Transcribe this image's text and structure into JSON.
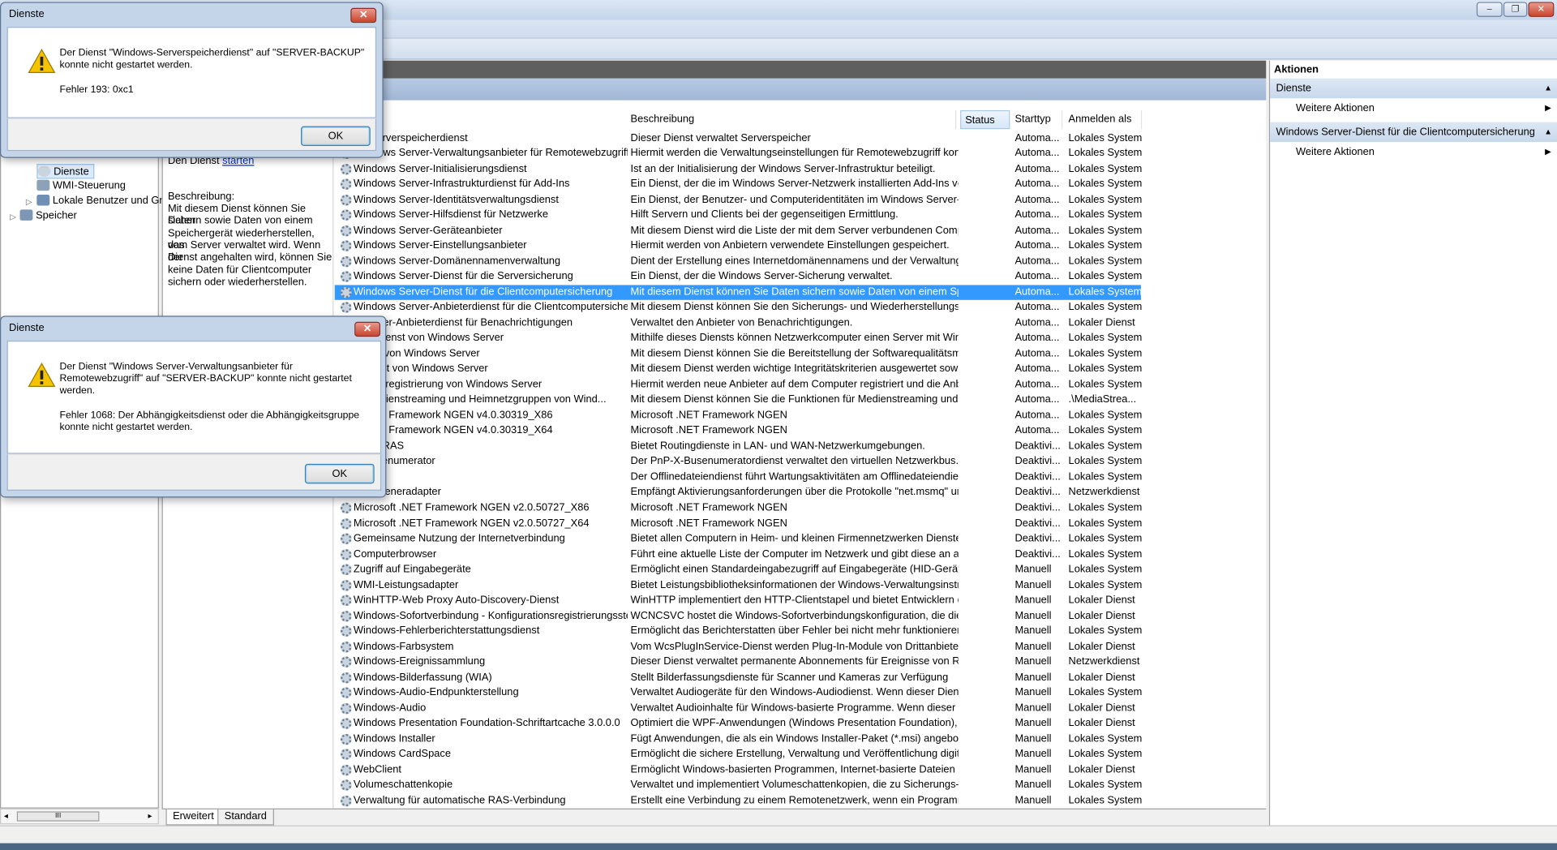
{
  "window": {
    "minimize": "‒",
    "maximize": "❐",
    "close": "✕"
  },
  "tree": {
    "items": [
      {
        "label": "Dienste",
        "selected": true
      },
      {
        "label": "WMI-Steuerung"
      },
      {
        "label": "Lokale Benutzer und Gru"
      },
      {
        "label": "Speicher"
      }
    ],
    "hscroll_thumb": "III"
  },
  "detail": {
    "start_prefix": "Den Dienst",
    "start_link": "starten",
    "desc_heading": "Beschreibung:",
    "desc_lines": [
      "Mit diesem Dienst können Sie Daten",
      "sichern sowie Daten von einem",
      "Speichergerät wiederherstellen, das",
      "vom Server verwaltet wird. Wenn der",
      "Dienst angehalten wird, können Sie",
      "keine Daten für Clientcomputer",
      "sichern oder wiederherstellen."
    ]
  },
  "columns": {
    "description": "Beschreibung",
    "status": "Status",
    "starttype": "Starttyp",
    "logon": "Anmelden als"
  },
  "services": [
    {
      "name": "ws-Serverspeicherdienst",
      "desc": "Dieser Dienst verwaltet Serverspeicher",
      "start": "Automa...",
      "logon": "Lokales System"
    },
    {
      "name": "Windows Server-Verwaltungsanbieter für Remotewebzugriff",
      "desc": "Hiermit werden die Verwaltungseinstellungen für Remotewebzugriff konfi...",
      "start": "Automa...",
      "logon": "Lokales System"
    },
    {
      "name": "Windows Server-Initialisierungsdienst",
      "desc": "Ist an der Initialisierung der Windows Server-Infrastruktur beteiligt.",
      "start": "Automa...",
      "logon": "Lokales System"
    },
    {
      "name": "Windows Server-Infrastrukturdienst für Add-Ins",
      "desc": "Ein Dienst, der die im Windows Server-Netzwerk installierten Add-Ins verw...",
      "start": "Automa...",
      "logon": "Lokales System"
    },
    {
      "name": "Windows Server-Identitätsverwaltungsdienst",
      "desc": "Ein Dienst, der Benutzer- und Computeridentitäten im Windows Server-N...",
      "start": "Automa...",
      "logon": "Lokales System"
    },
    {
      "name": "Windows Server-Hilfsdienst für Netzwerke",
      "desc": "Hilft Servern und Clients bei der gegenseitigen Ermittlung.",
      "start": "Automa...",
      "logon": "Lokales System"
    },
    {
      "name": "Windows Server-Geräteanbieter",
      "desc": "Mit diesem Dienst wird die Liste der mit dem Server verbundenen Comput...",
      "start": "Automa...",
      "logon": "Lokales System"
    },
    {
      "name": "Windows Server-Einstellungsanbieter",
      "desc": "Hiermit werden von Anbietern verwendete Einstellungen gespeichert.",
      "start": "Automa...",
      "logon": "Lokales System"
    },
    {
      "name": "Windows Server-Domänennamenverwaltung",
      "desc": "Dient der Erstellung eines Internetdomänennamens und der Verwaltung d...",
      "start": "Automa...",
      "logon": "Lokales System"
    },
    {
      "name": "Windows Server-Dienst für die Serversicherung",
      "desc": "Ein Dienst, der die Windows Server-Sicherung verwaltet.",
      "start": "Automa...",
      "logon": "Lokales System"
    },
    {
      "name": "Windows Server-Dienst für die Clientcomputersicherung",
      "desc": "Mit diesem Dienst können Sie Daten sichern sowie Daten von einem Speic...",
      "start": "Automa...",
      "logon": "Lokales System",
      "selected": true
    },
    {
      "name": "Windows Server-Anbieterdienst für die Clientcomputersicher...",
      "desc": "Mit diesem Dienst können Sie den Sicherungs- und Wiederherstellungsdie...",
      "start": "Automa...",
      "logon": "Lokales System"
    },
    {
      "name": "s Server-Anbieterdienst für Benachrichtigungen",
      "desc": "Verwaltet den Anbieter von Benachrichtigungen.",
      "start": "Automa...",
      "logon": "Lokaler Dienst"
    },
    {
      "name": "erätedienst von Windows Server",
      "desc": "Mithilfe dieses Diensts können Netzwerkcomputer einen Server mit Windo...",
      "start": "Automa...",
      "logon": "Lokales System"
    },
    {
      "name": "dienst von Windows Server",
      "desc": "Mit diesem Dienst können Sie die Bereitstellung der Softwarequalitätsmetr...",
      "start": "Automa...",
      "logon": "Lokales System"
    },
    {
      "name": "tsdienst von Windows Server",
      "desc": "Mit diesem Dienst werden wichtige Integritätskriterien ausgewertet sowie ...",
      "start": "Automa...",
      "logon": "Lokales System"
    },
    {
      "name": "nbieterregistrierung von Windows Server",
      "desc": "Hiermit werden neue Anbieter auf dem Computer registriert und die Anbi...",
      "start": "Automa...",
      "logon": "Lokales System"
    },
    {
      "name": "ür Medienstreaming und Heimnetzgruppen von Wind...",
      "desc": "Mit diesem Dienst können Sie die Funktionen für Medienstreaming und H...",
      "start": "Automa...",
      "logon": ".\\MediaStrea..."
    },
    {
      "name": "ft .NET Framework NGEN v4.0.30319_X86",
      "desc": "Microsoft .NET Framework NGEN",
      "start": "Automa...",
      "logon": "Lokales System"
    },
    {
      "name": "ft .NET Framework NGEN v4.0.30319_X64",
      "desc": "Microsoft .NET Framework NGEN",
      "start": "Automa...",
      "logon": "Lokales System"
    },
    {
      "name": "g und RAS",
      "desc": "Bietet Routingdienste in LAN- und WAN-Netzwerkumgebungen.",
      "start": "Deaktivi...",
      "logon": "Lokales System"
    },
    {
      "name": "P-Busenumerator",
      "desc": "Der PnP-X-Busenumeratordienst verwaltet den virtuellen Netzwerkbus. Er ...",
      "start": "Deaktivi...",
      "logon": "Lokales System"
    },
    {
      "name": "ateien",
      "desc": "Der Offlinedateiendienst führt Wartungsaktivitäten am Offlinedateiendien...",
      "start": "Deaktivi...",
      "logon": "Lokales System"
    },
    {
      "name": "nq-Listeneradapter",
      "desc": "Empfängt Aktivierungsanforderungen über die Protokolle \"net.msmq\" un...",
      "start": "Deaktivi...",
      "logon": "Netzwerkdienst"
    },
    {
      "name": "Microsoft .NET Framework NGEN v2.0.50727_X86",
      "desc": "Microsoft .NET Framework NGEN",
      "start": "Deaktivi...",
      "logon": "Lokales System"
    },
    {
      "name": "Microsoft .NET Framework NGEN v2.0.50727_X64",
      "desc": "Microsoft .NET Framework NGEN",
      "start": "Deaktivi...",
      "logon": "Lokales System"
    },
    {
      "name": "Gemeinsame Nutzung der Internetverbindung",
      "desc": "Bietet allen Computern in Heim- und kleinen Firmennetzwerken Dienste f...",
      "start": "Deaktivi...",
      "logon": "Lokales System"
    },
    {
      "name": "Computerbrowser",
      "desc": "Führt eine aktuelle Liste der Computer im Netzwerk und gibt diese an als ...",
      "start": "Deaktivi...",
      "logon": "Lokales System"
    },
    {
      "name": "Zugriff auf Eingabegeräte",
      "desc": "Ermöglicht einen Standardeingabezugriff auf Eingabegeräte (HID-Geräte), ...",
      "start": "Manuell",
      "logon": "Lokales System"
    },
    {
      "name": "WMI-Leistungsadapter",
      "desc": "Bietet Leistungsbibliotheksinformationen der Windows-Verwaltungsinstru...",
      "start": "Manuell",
      "logon": "Lokales System"
    },
    {
      "name": "WinHTTP-Web Proxy Auto-Discovery-Dienst",
      "desc": "WinHTTP implementiert den HTTP-Clientstapel und bietet Entwicklern ei...",
      "start": "Manuell",
      "logon": "Lokaler Dienst"
    },
    {
      "name": "Windows-Sofortverbindung - Konfigurationsregistrierungsste...",
      "desc": "WCNCSVC hostet die Windows-Sofortverbindungskonfiguration, die die I...",
      "start": "Manuell",
      "logon": "Lokaler Dienst"
    },
    {
      "name": "Windows-Fehlerberichterstattungsdienst",
      "desc": "Ermöglicht das Berichterstatten über Fehler bei nicht mehr funktionierend...",
      "start": "Manuell",
      "logon": "Lokales System"
    },
    {
      "name": "Windows-Farbsystem",
      "desc": "Vom WcsPlugInService-Dienst werden Plug-In-Module von Drittanbietern...",
      "start": "Manuell",
      "logon": "Lokaler Dienst"
    },
    {
      "name": "Windows-Ereignissammlung",
      "desc": "Dieser Dienst verwaltet permanente Abonnements für Ereignisse von Rem...",
      "start": "Manuell",
      "logon": "Netzwerkdienst"
    },
    {
      "name": "Windows-Bilderfassung (WIA)",
      "desc": "Stellt Bilderfassungsdienste für Scanner und Kameras zur Verfügung",
      "start": "Manuell",
      "logon": "Lokaler Dienst"
    },
    {
      "name": "Windows-Audio-Endpunkterstellung",
      "desc": "Verwaltet Audiogeräte für den Windows-Audiodienst. Wenn dieser Dienst ...",
      "start": "Manuell",
      "logon": "Lokales System"
    },
    {
      "name": "Windows-Audio",
      "desc": "Verwaltet Audioinhalte für Windows-basierte Programme. Wenn dieser Di...",
      "start": "Manuell",
      "logon": "Lokaler Dienst"
    },
    {
      "name": "Windows Presentation Foundation-Schriftartcache 3.0.0.0",
      "desc": "Optimiert die WPF-Anwendungen (Windows Presentation Foundation), in...",
      "start": "Manuell",
      "logon": "Lokaler Dienst"
    },
    {
      "name": "Windows Installer",
      "desc": "Fügt Anwendungen, die als ein Windows Installer-Paket (*.msi) angebote...",
      "start": "Manuell",
      "logon": "Lokales System"
    },
    {
      "name": "Windows CardSpace",
      "desc": "Ermöglicht die sichere Erstellung, Verwaltung und Veröffentlichung digital...",
      "start": "Manuell",
      "logon": "Lokales System"
    },
    {
      "name": "WebClient",
      "desc": "Ermöglicht Windows-basierten Programmen, Internet-basierte Dateien zu ...",
      "start": "Manuell",
      "logon": "Lokaler Dienst"
    },
    {
      "name": "Volumeschattenkopie",
      "desc": "Verwaltet und implementiert Volumeschattenkopien, die zu Sicherungs- u...",
      "start": "Manuell",
      "logon": "Lokales System"
    },
    {
      "name": "Verwaltung für automatische RAS-Verbindung",
      "desc": "Erstellt eine Verbindung zu einem Remotenetzwerk, wenn ein Programm e...",
      "start": "Manuell",
      "logon": "Lokales System"
    }
  ],
  "tabs": {
    "extended": "Erweitert",
    "standard": "Standard"
  },
  "actions": {
    "title": "Aktionen",
    "sections": [
      {
        "label": "Dienste",
        "item": "Weitere Aktionen"
      },
      {
        "label": "Windows Server-Dienst für die Clientcomputersicherung",
        "item": "Weitere Aktionen"
      }
    ]
  },
  "dialog1": {
    "title": "Dienste",
    "lines": [
      "Der Dienst \"Windows-Serverspeicherdienst\" auf \"SERVER-BACKUP\"",
      "konnte nicht gestartet werden."
    ],
    "error": "Fehler 193: 0xc1",
    "ok": "OK"
  },
  "dialog2": {
    "title": "Dienste",
    "lines": [
      "Der Dienst \"Windows Server-Verwaltungsanbieter für",
      "Remotewebzugriff\" auf \"SERVER-BACKUP\" konnte nicht gestartet",
      "werden."
    ],
    "error_lines": [
      "Fehler 1068: Der Abhängigkeitsdienst oder die Abhängigkeitsgruppe",
      "konnte nicht gestartet werden."
    ],
    "ok": "OK"
  },
  "colors": {
    "selection": "#3399ff",
    "title_gradient": "#c4d5ea",
    "warning": "#f5c400"
  }
}
